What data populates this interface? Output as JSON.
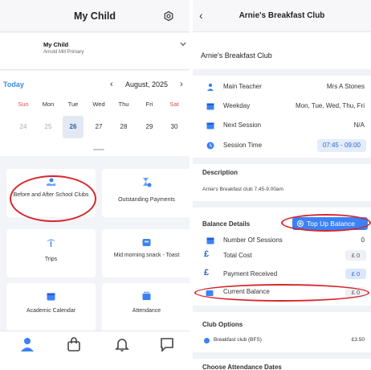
{
  "left": {
    "header": {
      "title": "My Child"
    },
    "child": {
      "name": "My Child",
      "school": "Arnold Mill Primary"
    },
    "calendar": {
      "today_label": "Today",
      "month": "August, 2025",
      "prev_symbol": "‹",
      "next_symbol": "›",
      "weekdays": [
        "Sun",
        "Mon",
        "Tue",
        "Wed",
        "Thu",
        "Fri",
        "Sat"
      ],
      "dates": [
        "24",
        "25",
        "26",
        "27",
        "28",
        "29",
        "30"
      ],
      "selected_date": "26"
    },
    "tiles": [
      {
        "label": "Before and After School Clubs",
        "icon": "hand-coin-icon"
      },
      {
        "label": "Outstanding Payments",
        "icon": "hourglass-coin-icon"
      },
      {
        "label": "Trips",
        "icon": "palm-tree-icon"
      },
      {
        "label": "Mid morning snack - Toast",
        "icon": "snack-box-icon"
      },
      {
        "label": "Academic Calendar",
        "icon": "calendar-icon"
      },
      {
        "label": "Attendance",
        "icon": "attendance-icon"
      },
      {
        "label": "",
        "icon": "document-icon"
      },
      {
        "label": "",
        "icon": "clipboard-icon"
      }
    ],
    "bottom_nav": [
      "person-icon",
      "shopping-bag-icon",
      "bell-icon",
      "chat-icon"
    ]
  },
  "right": {
    "header": {
      "title": "Arnie's Breakfast Club",
      "back_symbol": "‹"
    },
    "club_name": "Arnie's Breakfast Club",
    "details": [
      {
        "label": "Main Teacher",
        "value": "Mrs A Stones",
        "icon": "person-icon"
      },
      {
        "label": "Weekday",
        "value": "Mon, Tue, Wed, Thu, Fri",
        "icon": "calendar-icon"
      },
      {
        "label": "Next Session",
        "value": "N/A",
        "icon": "calendar-icon"
      },
      {
        "label": "Session Time",
        "value": "07:45 - 09:00",
        "icon": "clock-icon"
      }
    ],
    "description": {
      "title": "Description",
      "text": "Arnie's Breakfast club 7.45-9.00am"
    },
    "balance": {
      "title": "Balance Details",
      "top_up_label": "Top Up Balance",
      "rows": [
        {
          "label": "Number Of Sessions",
          "value": "0"
        },
        {
          "label": "Total Cost",
          "value": "£ 0"
        },
        {
          "label": "Payment Received",
          "value": "£ 0"
        },
        {
          "label": "Current Balance",
          "value": "£ 0"
        }
      ]
    },
    "club_options": {
      "title": "Club Options",
      "option_label": "Breakfast club (BFS)",
      "option_price": "£3.50"
    },
    "next_section": "Choose Attendance Dates"
  },
  "colors": {
    "accent": "#3b82f6",
    "weekend": "#e24b4b",
    "annotation": "#d7262b"
  }
}
